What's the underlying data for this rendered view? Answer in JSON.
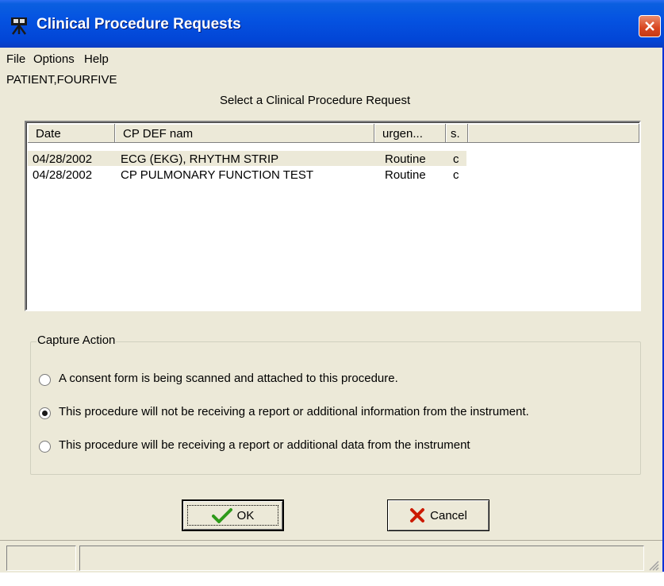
{
  "window": {
    "title": "Clinical Procedure Requests",
    "app_icon": "camera-tripod-icon"
  },
  "menu": [
    "File",
    "Options",
    "Help"
  ],
  "patient_name": "PATIENT,FOURFIVE",
  "select_label": "Select a Clinical Procedure Request",
  "list": {
    "columns": [
      "Date",
      "CP DEF nam",
      "urgen...",
      "s."
    ],
    "rows": [
      {
        "date": "04/28/2002",
        "name": "ECG (EKG), RHYTHM STRIP",
        "urgency": "Routine",
        "status": "c",
        "selected": true
      },
      {
        "date": "04/28/2002",
        "name": "CP PULMONARY FUNCTION TEST",
        "urgency": "Routine",
        "status": "c",
        "selected": false
      }
    ]
  },
  "capture": {
    "title": "Capture Action",
    "options": [
      {
        "label": "A consent form is being scanned and attached to this procedure.",
        "checked": false
      },
      {
        "label": "This procedure will not be receiving a report or additional information from the instrument.",
        "checked": true
      },
      {
        "label": "This procedure will be receiving a report or additional data from the instrument",
        "checked": false
      }
    ]
  },
  "buttons": {
    "ok": "OK",
    "cancel": "Cancel"
  },
  "colors": {
    "title_bar": "#0553e1",
    "close": "#d8451f",
    "window_bg": "#ece9d8",
    "ok_check": "#2e9a1a",
    "cancel_x": "#cc1a00"
  }
}
